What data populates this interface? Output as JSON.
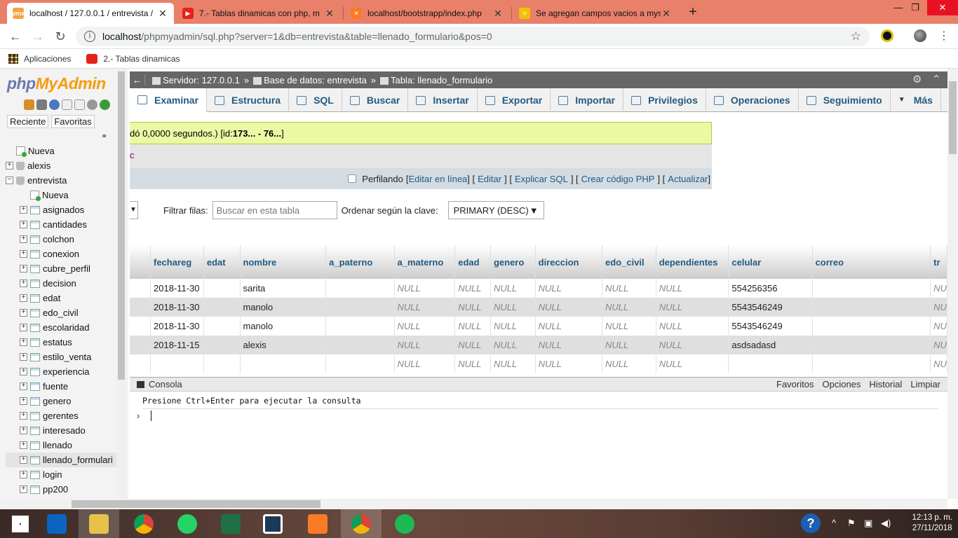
{
  "browser": {
    "tabs": [
      {
        "title": "localhost / 127.0.0.1 / entrevista /",
        "icon": "phpmyadmin-icon",
        "active": true
      },
      {
        "title": "7.- Tablas dinamicas con php, m",
        "icon": "youtube-icon",
        "active": false
      },
      {
        "title": "localhost/bootstrapp/index.php",
        "icon": "xampp-icon",
        "active": false
      },
      {
        "title": "Se agregan campos vacios a mys",
        "icon": "stackoverflow-icon",
        "active": false
      }
    ],
    "url_host": "localhost",
    "url_path": "/phpmyadmin/sql.php?server=1&db=entrevista&table=llenado_formulario&pos=0",
    "bookmarks": [
      {
        "label": "Aplicaciones",
        "icon": "apps-grid-icon"
      },
      {
        "label": "2.- Tablas dinamicas",
        "icon": "youtube-icon"
      }
    ]
  },
  "sidebar": {
    "logo_php": "php",
    "logo_admin": "MyAdmin",
    "tabs": [
      "Reciente",
      "Favoritas"
    ],
    "tree": [
      {
        "label": "Nueva",
        "level": 0,
        "kind": "new"
      },
      {
        "label": "alexis",
        "level": 0,
        "kind": "db"
      },
      {
        "label": "entrevista",
        "level": 0,
        "kind": "db-open"
      },
      {
        "label": "Nueva",
        "level": 1,
        "kind": "new"
      },
      {
        "label": "asignados",
        "level": 1,
        "kind": "table"
      },
      {
        "label": "cantidades",
        "level": 1,
        "kind": "table"
      },
      {
        "label": "colchon",
        "level": 1,
        "kind": "table"
      },
      {
        "label": "conexion",
        "level": 1,
        "kind": "table"
      },
      {
        "label": "cubre_perfil",
        "level": 1,
        "kind": "table"
      },
      {
        "label": "decision",
        "level": 1,
        "kind": "table"
      },
      {
        "label": "edat",
        "level": 1,
        "kind": "table"
      },
      {
        "label": "edo_civil",
        "level": 1,
        "kind": "table"
      },
      {
        "label": "escolaridad",
        "level": 1,
        "kind": "table"
      },
      {
        "label": "estatus",
        "level": 1,
        "kind": "table"
      },
      {
        "label": "estilo_venta",
        "level": 1,
        "kind": "table"
      },
      {
        "label": "experiencia",
        "level": 1,
        "kind": "table"
      },
      {
        "label": "fuente",
        "level": 1,
        "kind": "table"
      },
      {
        "label": "genero",
        "level": 1,
        "kind": "table"
      },
      {
        "label": "gerentes",
        "level": 1,
        "kind": "table"
      },
      {
        "label": "interesado",
        "level": 1,
        "kind": "table"
      },
      {
        "label": "llenado",
        "level": 1,
        "kind": "table"
      },
      {
        "label": "llenado_formulari",
        "level": 1,
        "kind": "table",
        "selected": true
      },
      {
        "label": "login",
        "level": 1,
        "kind": "table"
      },
      {
        "label": "pp200",
        "level": 1,
        "kind": "table"
      }
    ]
  },
  "breadcrumb": {
    "server": "Servidor: 127.0.0.1",
    "database": "Base de datos: entrevista",
    "table": "Tabla: llenado_formulario",
    "sep": "»"
  },
  "menu_tabs": [
    {
      "label": "Examinar",
      "active": true
    },
    {
      "label": "Estructura"
    },
    {
      "label": "SQL"
    },
    {
      "label": "Buscar"
    },
    {
      "label": "Insertar"
    },
    {
      "label": "Exportar"
    },
    {
      "label": "Importar"
    },
    {
      "label": "Privilegios"
    },
    {
      "label": "Operaciones"
    },
    {
      "label": "Seguimiento"
    },
    {
      "label": "Más"
    }
  ],
  "success_prefix": "dó 0,0000 segundos.) [id: ",
  "success_id": "173... - 76...",
  "success_suffix": "]",
  "sql_text": "c",
  "sql_options": {
    "profiling": "Perfilando",
    "links": [
      "Editar en línea",
      "Editar",
      "Explicar SQL",
      "Crear código PHP",
      "Actualizar"
    ]
  },
  "filter": {
    "label": "Filtrar filas:",
    "placeholder": "Buscar en esta tabla",
    "sort_label": "Ordenar según la clave:",
    "sort_value": "PRIMARY (DESC)"
  },
  "table": {
    "columns": [
      "fechareg",
      "edat",
      "nombre",
      "a_paterno",
      "a_materno",
      "edad",
      "genero",
      "direccion",
      "edo_civil",
      "dependientes",
      "celular",
      "correo",
      "tr"
    ],
    "rows": [
      [
        "2018-11-30",
        "",
        "sarita",
        "",
        "NULL",
        "NULL",
        "NULL",
        "NULL",
        "NULL",
        "NULL",
        "554256356",
        "",
        "NU"
      ],
      [
        "2018-11-30",
        "",
        "manolo",
        "",
        "NULL",
        "NULL",
        "NULL",
        "NULL",
        "NULL",
        "NULL",
        "5543546249",
        "",
        "NU"
      ],
      [
        "2018-11-30",
        "",
        "manolo",
        "",
        "NULL",
        "NULL",
        "NULL",
        "NULL",
        "NULL",
        "NULL",
        "5543546249",
        "",
        "NU"
      ],
      [
        "2018-11-15",
        "",
        "alexis",
        "",
        "NULL",
        "NULL",
        "NULL",
        "NULL",
        "NULL",
        "NULL",
        "asdsadasd",
        "",
        "NU"
      ],
      [
        "",
        "",
        "",
        "",
        "NULL",
        "NULL",
        "NULL",
        "NULL",
        "NULL",
        "NULL",
        "",
        "",
        "NU"
      ]
    ]
  },
  "console": {
    "title": "Consola",
    "actions": [
      "Favoritos",
      "Opciones",
      "Historial",
      "Limpiar"
    ],
    "hint": "Presione Ctrl+Enter para ejecutar la consulta",
    "prompt": "›"
  },
  "taskbar": {
    "time": "12:13 p. m.",
    "date": "27/11/2018",
    "apps": [
      "windows-start-icon",
      "outlook-icon",
      "file-explorer-icon",
      "chrome-icon",
      "whatsapp-icon",
      "excel-icon",
      "notes-app-icon",
      "xampp-icon",
      "chrome-icon",
      "spotify-icon"
    ]
  },
  "colors": {
    "tabstrip": "#e9806a",
    "pma_link": "#235a81",
    "success_bg": "#ebf8a4"
  }
}
